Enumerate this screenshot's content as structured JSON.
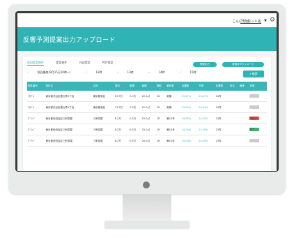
{
  "header": {
    "greeting": "こんにちは、",
    "account": "アカウント名",
    "user_drop": "▼"
  },
  "banner": {
    "title": "反響予測提案出力アップロード"
  },
  "tabs": [
    "前回提案物件",
    "提案物件",
    "外部提案",
    "PDF提案"
  ],
  "buttons": {
    "primary": "提案出力",
    "secondary": "提案書ダウンロード",
    "search": "検索"
  },
  "filters": [
    "前回最終(9月15日10時〜)",
    "12時",
    "13時",
    "14時",
    "15時"
  ],
  "table": {
    "headers": [
      "物件番号",
      "物件名",
      "住所",
      "賃料",
      "管理",
      "面積",
      "間取",
      "築年数",
      "反響数",
      "予測",
      "反響率",
      "担当",
      "備考",
      "状態"
    ],
    "rows": [
      [
        "ｱｸｶﾞ1",
        "東京都渋谷区恵比寿1丁目",
        "東京都港区",
        "13.3万",
        "2.0万",
        "22.0㎡",
        "1K",
        "新築",
        "23.47%",
        "23.47%",
        "10件",
        "",
        "",
        ""
      ],
      [
        "ｱｸｶﾞ1",
        "東京都渋谷区恵比寿1丁目",
        "東京都港区",
        "13.3万",
        "2.0万",
        "22.0㎡",
        "1K",
        "新築",
        "23.47%",
        "23.47%",
        "10件",
        "",
        "",
        ""
      ],
      [
        "ｸﾞﾗﾝﾄﾞ",
        "東京都世田谷区三軒茶屋",
        "三軒茶屋",
        "8.2万",
        "0.5万",
        "25.0㎡",
        "1R",
        "築15年",
        "24.20%",
        "24.20%",
        "13件",
        "",
        "",
        "対応中"
      ],
      [
        "ｸﾞﾗﾝﾄﾞ",
        "東京都世田谷区三軒茶屋",
        "三軒茶屋",
        "8.2万",
        "0.5万",
        "25.0㎡",
        "1R",
        "築15年",
        "24.20%",
        "24.20%",
        "13件",
        "",
        "",
        "完了"
      ],
      [
        "ｸﾞﾗﾝﾄﾞ",
        "東京都世田谷区三軒茶屋",
        "三軒茶屋",
        "8.2万",
        "0.5万",
        "25.0㎡",
        "1R",
        "築15年",
        "24.20%",
        "24.20%",
        "13件",
        "",
        "",
        ""
      ]
    ],
    "status_colors": [
      "#cccccc",
      "#cccccc",
      "#e74c3c",
      "#3cb371",
      "#cccccc"
    ]
  },
  "colors": {
    "accent": "#2fb3b5"
  },
  "icons": {
    "settings": "gear-icon",
    "checks": "check-icon",
    "search": "search-icon"
  }
}
